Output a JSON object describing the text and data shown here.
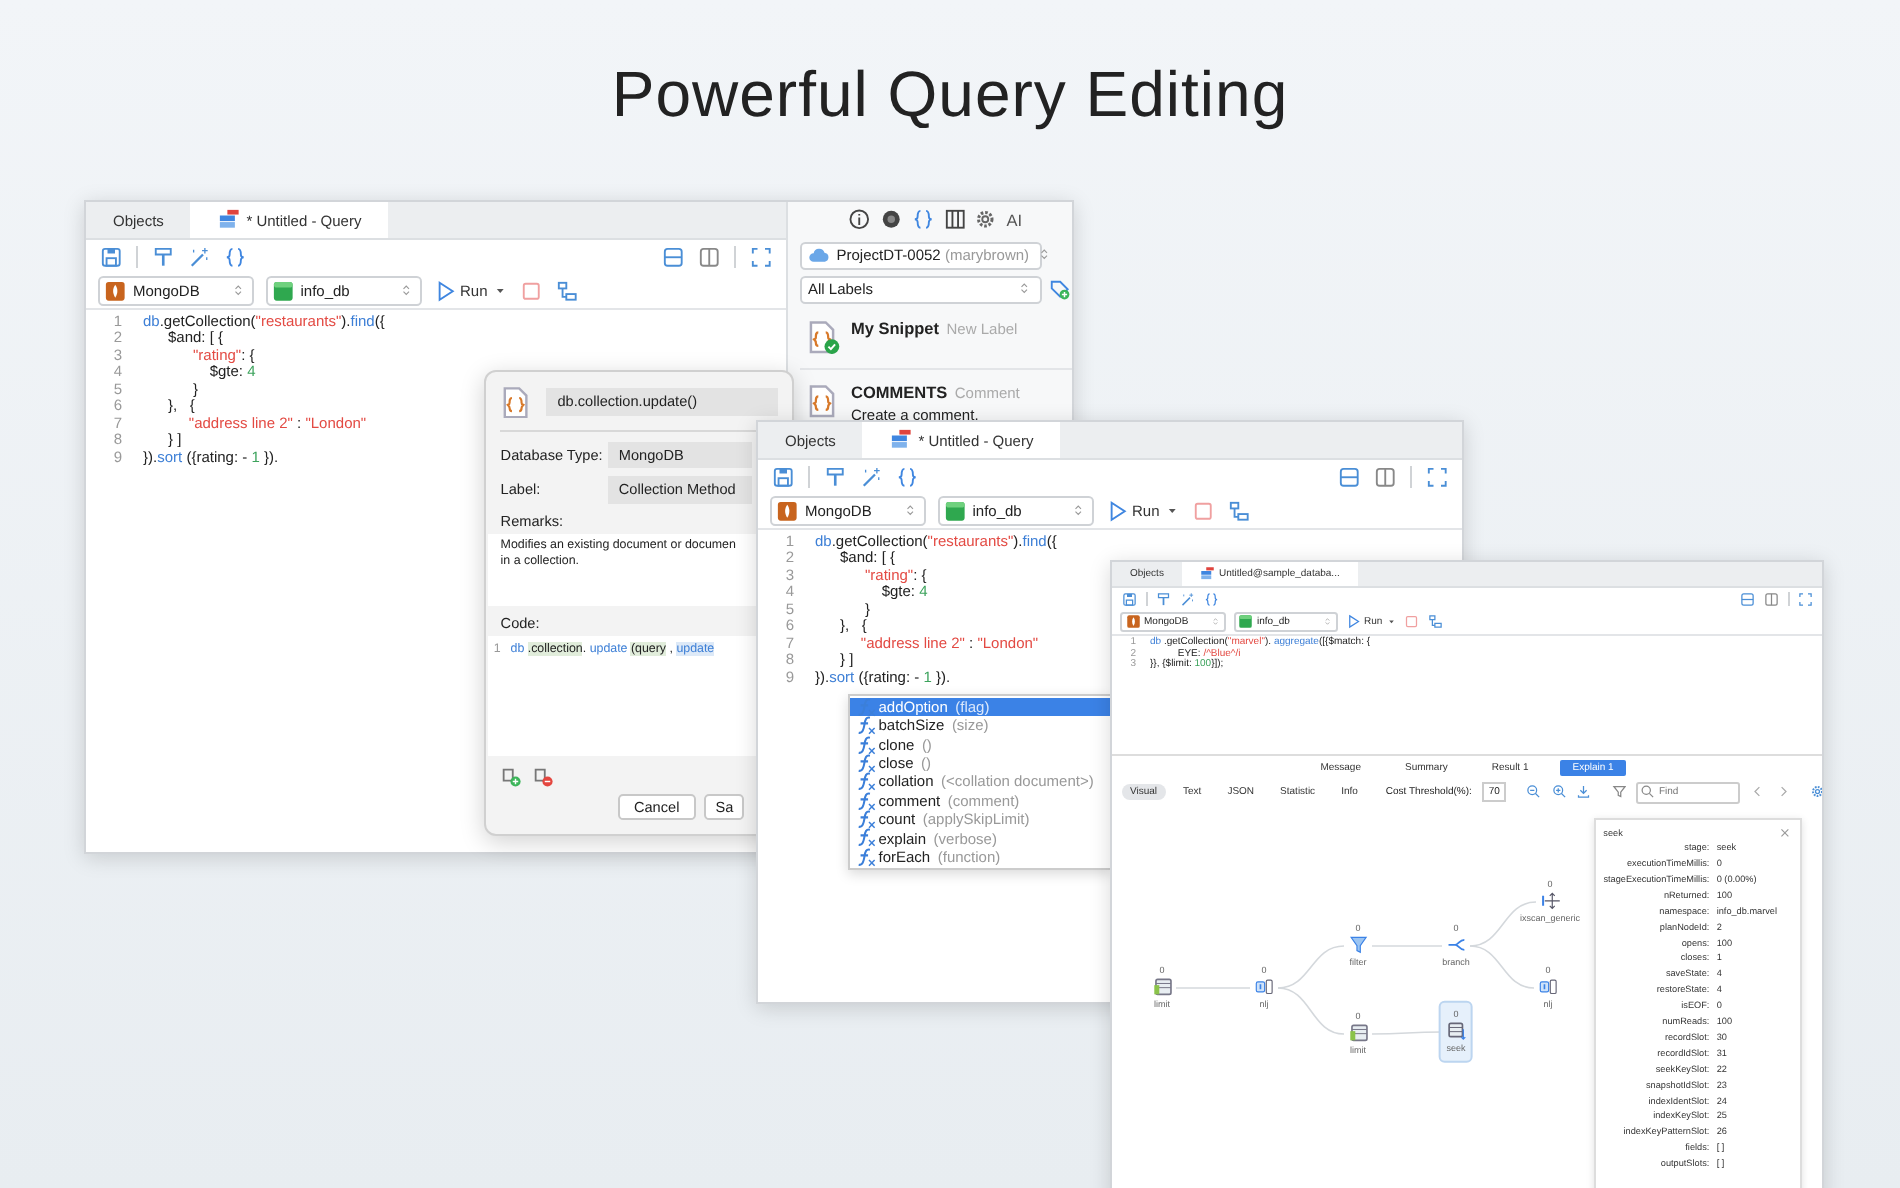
{
  "heading": "Powerful Query Editing",
  "query_window": {
    "tabs": [
      {
        "kind": "objects",
        "label": "Objects",
        "selected": false
      },
      {
        "kind": "query",
        "label": "* Untitled - Query",
        "selected": true
      }
    ],
    "connection": "MongoDB",
    "database": "info_db",
    "run_button": "Run",
    "code_lines": [
      {
        "number": "1",
        "tokens": [
          {
            "kind": "fn",
            "text": "db"
          },
          {
            "kind": "plain",
            "text": ".getCollection("
          },
          {
            "kind": "str",
            "text": "\"restaurants\""
          },
          {
            "kind": "plain",
            "text": ")."
          },
          {
            "kind": "fn",
            "text": "find"
          },
          {
            "kind": "plain",
            "text": "({"
          }
        ]
      },
      {
        "number": "2",
        "tokens": [
          {
            "kind": "plain",
            "text": "      $and: [ {"
          }
        ]
      },
      {
        "number": "3",
        "tokens": [
          {
            "kind": "str",
            "text": "            \"rating\""
          },
          {
            "kind": "plain",
            "text": ": {"
          }
        ]
      },
      {
        "number": "4",
        "tokens": [
          {
            "kind": "plain",
            "text": "                $gte: "
          },
          {
            "kind": "num",
            "text": "4"
          }
        ]
      },
      {
        "number": "5",
        "tokens": [
          {
            "kind": "plain",
            "text": "            }"
          }
        ]
      },
      {
        "number": "6",
        "tokens": [
          {
            "kind": "plain",
            "text": "      },   {"
          }
        ]
      },
      {
        "number": "7",
        "tokens": [
          {
            "kind": "str",
            "text": "           \"address line 2\""
          },
          {
            "kind": "plain",
            "text": " : "
          },
          {
            "kind": "str",
            "text": "\"London\""
          }
        ]
      },
      {
        "number": "8",
        "tokens": [
          {
            "kind": "plain",
            "text": "      } ]"
          }
        ]
      },
      {
        "number": "9",
        "tokens": [
          {
            "kind": "plain",
            "text": "})."
          },
          {
            "kind": "fn",
            "text": "sort"
          },
          {
            "kind": "plain",
            "text": " ({rating: - "
          },
          {
            "kind": "num",
            "text": "1"
          },
          {
            "kind": "plain",
            "text": " })."
          }
        ]
      }
    ]
  },
  "snippets_panel": {
    "ai_button": "AI",
    "project": "ProjectDT-0052",
    "owner": "(marybrown)",
    "label_filter": "All Labels",
    "snippets": [
      {
        "title": "My Snippet",
        "label": "New Label",
        "added": true
      },
      {
        "title": "COMMENTS",
        "label": "Comment",
        "description": "Create a comment.",
        "added": false
      }
    ]
  },
  "snippet_dialog": {
    "name": "db.collection.update()",
    "fields": [
      {
        "label": "Database Type:",
        "value": "MongoDB"
      },
      {
        "label": "Label:",
        "value": "Collection Method"
      }
    ],
    "remarks_label": "Remarks:",
    "remarks": "Modifies an existing document or documen\nin a collection.",
    "code_label": "Code:",
    "code_lines": [
      {
        "number": "1",
        "tokens": [
          {
            "kind": "fn",
            "text": "db "
          },
          {
            "kind": "hl",
            "text": ".collection"
          },
          {
            "kind": "plain",
            "text": ". "
          },
          {
            "kind": "fn",
            "text": "update "
          },
          {
            "kind": "hl",
            "text": "(query"
          },
          {
            "kind": "plain",
            "text": " , "
          },
          {
            "kind": "fnhl",
            "text": "update"
          }
        ]
      }
    ],
    "buttons": [
      "Cancel",
      "Sa"
    ]
  },
  "second_window": {
    "tabs": [
      {
        "kind": "objects",
        "label": "Objects",
        "selected": false
      },
      {
        "kind": "query",
        "label": "* Untitled - Query",
        "selected": true
      }
    ],
    "connection": "MongoDB",
    "database": "info_db",
    "run_button": "Run",
    "code_lines": [
      {
        "number": "1",
        "tokens": [
          {
            "kind": "fn",
            "text": "db"
          },
          {
            "kind": "plain",
            "text": ".getCollection("
          },
          {
            "kind": "str",
            "text": "\"restaurants\""
          },
          {
            "kind": "plain",
            "text": ")."
          },
          {
            "kind": "fn",
            "text": "find"
          },
          {
            "kind": "plain",
            "text": "({"
          }
        ]
      },
      {
        "number": "2",
        "tokens": [
          {
            "kind": "plain",
            "text": "      $and: [ {"
          }
        ]
      },
      {
        "number": "3",
        "tokens": [
          {
            "kind": "str",
            "text": "            \"rating\""
          },
          {
            "kind": "plain",
            "text": ": {"
          }
        ]
      },
      {
        "number": "4",
        "tokens": [
          {
            "kind": "plain",
            "text": "                $gte: "
          },
          {
            "kind": "num",
            "text": "4"
          }
        ]
      },
      {
        "number": "5",
        "tokens": [
          {
            "kind": "plain",
            "text": "            }"
          }
        ]
      },
      {
        "number": "6",
        "tokens": [
          {
            "kind": "plain",
            "text": "      },   {"
          }
        ]
      },
      {
        "number": "7",
        "tokens": [
          {
            "kind": "str",
            "text": "           \"address line 2\""
          },
          {
            "kind": "plain",
            "text": " : "
          },
          {
            "kind": "str",
            "text": "\"London\""
          }
        ]
      },
      {
        "number": "8",
        "tokens": [
          {
            "kind": "plain",
            "text": "      } ]"
          }
        ]
      },
      {
        "number": "9",
        "tokens": [
          {
            "kind": "plain",
            "text": "})."
          },
          {
            "kind": "fn",
            "text": "sort"
          },
          {
            "kind": "plain",
            "text": " ({rating: - "
          },
          {
            "kind": "num",
            "text": "1"
          },
          {
            "kind": "plain",
            "text": " })."
          }
        ]
      }
    ],
    "completions": [
      {
        "name": "addOption",
        "hint": "(flag)",
        "selected": true
      },
      {
        "name": "batchSize",
        "hint": "(size)",
        "selected": false
      },
      {
        "name": "clone",
        "hint": "()",
        "selected": false
      },
      {
        "name": "close",
        "hint": "()",
        "selected": false
      },
      {
        "name": "collation",
        "hint": "(<collation document>)",
        "selected": false
      },
      {
        "name": "comment",
        "hint": "(comment)",
        "selected": false
      },
      {
        "name": "count",
        "hint": "(applySkipLimit)",
        "selected": false
      },
      {
        "name": "explain",
        "hint": "(verbose)",
        "selected": false
      },
      {
        "name": "forEach",
        "hint": "(function)",
        "selected": false
      }
    ]
  },
  "explain_window": {
    "tabs": [
      {
        "kind": "objects",
        "label": "Objects",
        "selected": false
      },
      {
        "kind": "query",
        "label": "Untitled@sample_databa...",
        "selected": true
      }
    ],
    "connection": "MongoDB",
    "database": "info_db",
    "run_button": "Run",
    "code_lines": [
      {
        "number": "1",
        "tokens": [
          {
            "kind": "fn",
            "text": "db"
          },
          {
            "kind": "plain",
            "text": " .getCollection("
          },
          {
            "kind": "str",
            "text": "\"marvel\""
          },
          {
            "kind": "plain",
            "text": "). "
          },
          {
            "kind": "fn",
            "text": "aggregate"
          },
          {
            "kind": "plain",
            "text": "([{$match: {"
          }
        ]
      },
      {
        "number": "2",
        "tokens": [
          {
            "kind": "plain",
            "text": "          EYE: "
          },
          {
            "kind": "str",
            "text": "/^Blue^/i"
          }
        ]
      },
      {
        "number": "3",
        "tokens": [
          {
            "kind": "plain",
            "text": "}}, {$limit: "
          },
          {
            "kind": "num",
            "text": "100"
          },
          {
            "kind": "plain",
            "text": "}]);"
          }
        ]
      }
    ],
    "result_tabs": [
      {
        "label": "Message",
        "selected": false
      },
      {
        "label": "Summary",
        "selected": false
      },
      {
        "label": "Result 1",
        "selected": false
      },
      {
        "label": "Explain 1",
        "selected": true
      }
    ],
    "view_tabs": [
      {
        "label": "Visual",
        "selected": true
      },
      {
        "label": "Text",
        "selected": false
      },
      {
        "label": "JSON",
        "selected": false
      },
      {
        "label": "Statistic",
        "selected": false
      },
      {
        "label": "Info",
        "selected": false
      }
    ],
    "cost_threshold_label": "Cost Threshold(%):",
    "cost_threshold": "70",
    "find_placeholder": "Find",
    "plan_nodes": [
      {
        "kind": "table",
        "label": "limit",
        "count": "0",
        "selected": false
      },
      {
        "kind": "join",
        "label": "nlj",
        "count": "0",
        "selected": false
      },
      {
        "kind": "filter",
        "label": "filter",
        "count": "0",
        "selected": false
      },
      {
        "kind": "branch",
        "label": "branch",
        "count": "0",
        "selected": false
      },
      {
        "kind": "scan",
        "label": "ixscan_generic",
        "count": "0",
        "selected": false
      },
      {
        "kind": "join",
        "label": "nlj",
        "count": "0",
        "selected": false
      },
      {
        "kind": "table",
        "label": "limit",
        "count": "0",
        "selected": false
      },
      {
        "kind": "seek",
        "label": "seek",
        "count": "0",
        "selected": true
      }
    ],
    "details": {
      "title": "seek",
      "rows": [
        {
          "key": "stage:",
          "value": "seek"
        },
        {
          "key": "executionTimeMillis:",
          "value": "0"
        },
        {
          "key": "stageExecutionTimeMillis:",
          "value": "0 (0.00%)"
        },
        {
          "key": "nReturned:",
          "value": "100"
        },
        {
          "key": "namespace:",
          "value": "info_db.marvel"
        },
        {
          "key": "planNodeId:",
          "value": "2"
        },
        {
          "key": "opens:",
          "value": "100"
        },
        {
          "key": "closes:",
          "value": "1"
        },
        {
          "key": "saveState:",
          "value": "4"
        },
        {
          "key": "restoreState:",
          "value": "4"
        },
        {
          "key": "isEOF:",
          "value": "0"
        },
        {
          "key": "numReads:",
          "value": "100"
        },
        {
          "key": "recordSlot:",
          "value": "30"
        },
        {
          "key": "recordIdSlot:",
          "value": "31"
        },
        {
          "key": "seekKeySlot:",
          "value": "22"
        },
        {
          "key": "snapshotIdSlot:",
          "value": "23"
        },
        {
          "key": "indexIdentSlot:",
          "value": "24"
        },
        {
          "key": "indexKeySlot:",
          "value": "25"
        },
        {
          "key": "indexKeyPatternSlot:",
          "value": "26"
        },
        {
          "key": "fields:",
          "value": "[ ]"
        },
        {
          "key": "outputSlots:",
          "value": "[ ]"
        }
      ]
    }
  }
}
